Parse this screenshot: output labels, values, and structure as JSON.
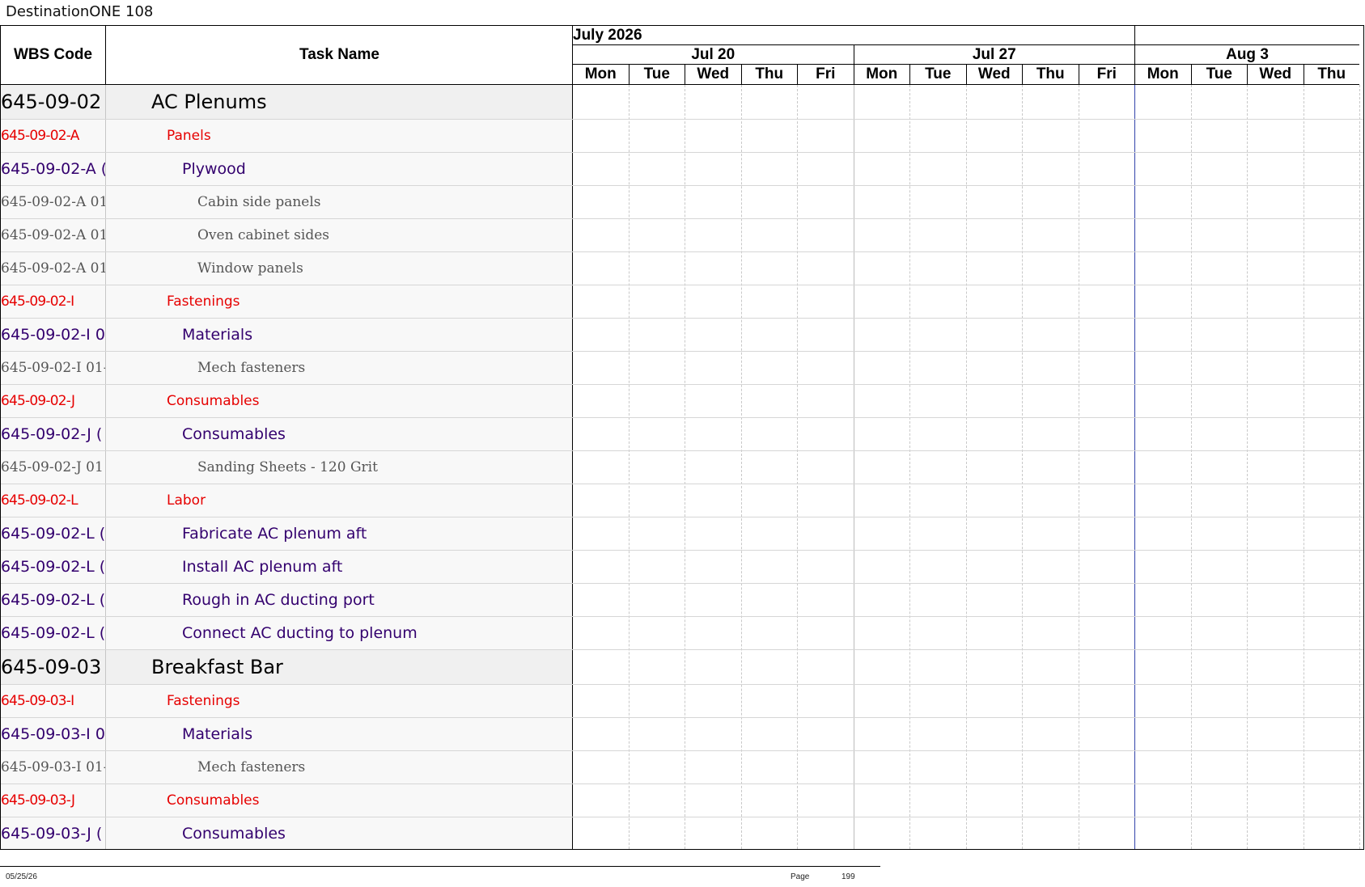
{
  "title": "DestinationONE 108",
  "header": {
    "wbs": "WBS Code",
    "task": "Task Name"
  },
  "calendar": {
    "months": [
      {
        "label": "July 2026",
        "days": 10
      },
      {
        "label": "",
        "days": 4
      }
    ],
    "weeks": [
      {
        "label": "Jul 20",
        "days": 5
      },
      {
        "label": "Jul 27",
        "days": 5
      },
      {
        "label": "Aug 3",
        "days": 4
      }
    ],
    "days": [
      "Mon",
      "Tue",
      "Wed",
      "Thu",
      "Fri",
      "Mon",
      "Tue",
      "Wed",
      "Thu",
      "Fri",
      "Mon",
      "Tue",
      "Wed",
      "Thu"
    ]
  },
  "rows": [
    {
      "wbs": "645-09-02",
      "task": "AC Plenums",
      "level": 0
    },
    {
      "wbs": "645-09-02-A",
      "task": "Panels",
      "level": 1
    },
    {
      "wbs": "645-09-02-A (",
      "task": "Plywood",
      "level": 2
    },
    {
      "wbs": "645-09-02-A 01",
      "task": "Cabin side panels",
      "level": 3
    },
    {
      "wbs": "645-09-02-A 01",
      "task": "Oven cabinet sides",
      "level": 3
    },
    {
      "wbs": "645-09-02-A 01",
      "task": "Window panels",
      "level": 3
    },
    {
      "wbs": "645-09-02-I",
      "task": "Fastenings",
      "level": 1
    },
    {
      "wbs": "645-09-02-I 0",
      "task": "Materials",
      "level": 2
    },
    {
      "wbs": "645-09-02-I 01-",
      "task": "Mech fasteners",
      "level": 3
    },
    {
      "wbs": "645-09-02-J",
      "task": "Consumables",
      "level": 1
    },
    {
      "wbs": "645-09-02-J (",
      "task": "Consumables",
      "level": 2
    },
    {
      "wbs": "645-09-02-J 01",
      "task": "Sanding Sheets - 120 Grit",
      "level": 3
    },
    {
      "wbs": "645-09-02-L",
      "task": "Labor",
      "level": 1
    },
    {
      "wbs": "645-09-02-L (",
      "task": "Fabricate AC plenum aft",
      "level": 2
    },
    {
      "wbs": "645-09-02-L (",
      "task": "Install AC plenum aft",
      "level": 2
    },
    {
      "wbs": "645-09-02-L (",
      "task": "Rough in AC ducting port",
      "level": 2
    },
    {
      "wbs": "645-09-02-L (",
      "task": "Connect AC ducting to plenum",
      "level": 2
    },
    {
      "wbs": "645-09-03",
      "task": "Breakfast Bar",
      "level": 0
    },
    {
      "wbs": "645-09-03-I",
      "task": "Fastenings",
      "level": 1
    },
    {
      "wbs": "645-09-03-I 0",
      "task": "Materials",
      "level": 2
    },
    {
      "wbs": "645-09-03-I 01-",
      "task": "Mech fasteners",
      "level": 3
    },
    {
      "wbs": "645-09-03-J",
      "task": "Consumables",
      "level": 1
    },
    {
      "wbs": "645-09-03-J (",
      "task": "Consumables",
      "level": 2
    }
  ],
  "footer": {
    "date": "05/25/26",
    "page_label": "Page",
    "page_number": "199"
  }
}
